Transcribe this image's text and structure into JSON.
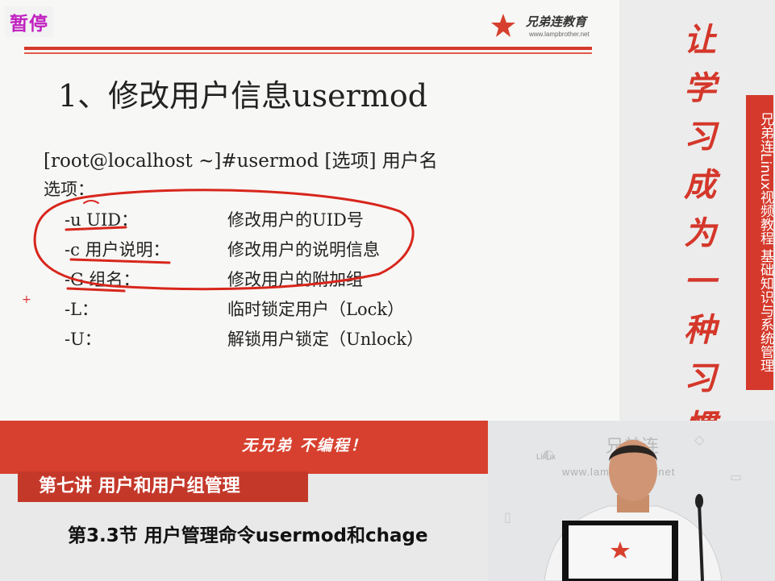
{
  "pause_label": "暂停",
  "logo": {
    "name": "兄弟连教育",
    "url": "www.lampbrother.net"
  },
  "slide": {
    "title": "1、修改用户信息usermod",
    "command": "[root@localhost ~]#usermod [选项] 用户名",
    "options_heading": "选项：",
    "options": [
      {
        "flag": "-u UID：",
        "desc": "修改用户的UID号"
      },
      {
        "flag": "-c 用户说明：",
        "desc": "修改用户的说明信息"
      },
      {
        "flag": "-G 组名：",
        "desc": "修改用户的附加组"
      },
      {
        "flag": "-L：",
        "desc": "临时锁定用户（Lock）"
      },
      {
        "flag": "-U：",
        "desc": "解锁用户锁定（Unlock）"
      }
    ]
  },
  "slogan": "让学习成为一种习惯",
  "side_tag": "兄弟连Linux视频教程 基础知识与系统管理",
  "motto": "无兄弟 不编程！",
  "lecture_title": "第七讲 用户和用户组管理",
  "section_title": "第3.3节 用户管理命令usermod和chage",
  "webcam": {
    "brand": "兄弟连",
    "url": "www.lampbrother.net",
    "linux_label": "Linux"
  },
  "colors": {
    "brand_red": "#d7402e",
    "pause_magenta": "#c020c0",
    "annotation_red": "#d8261c"
  }
}
